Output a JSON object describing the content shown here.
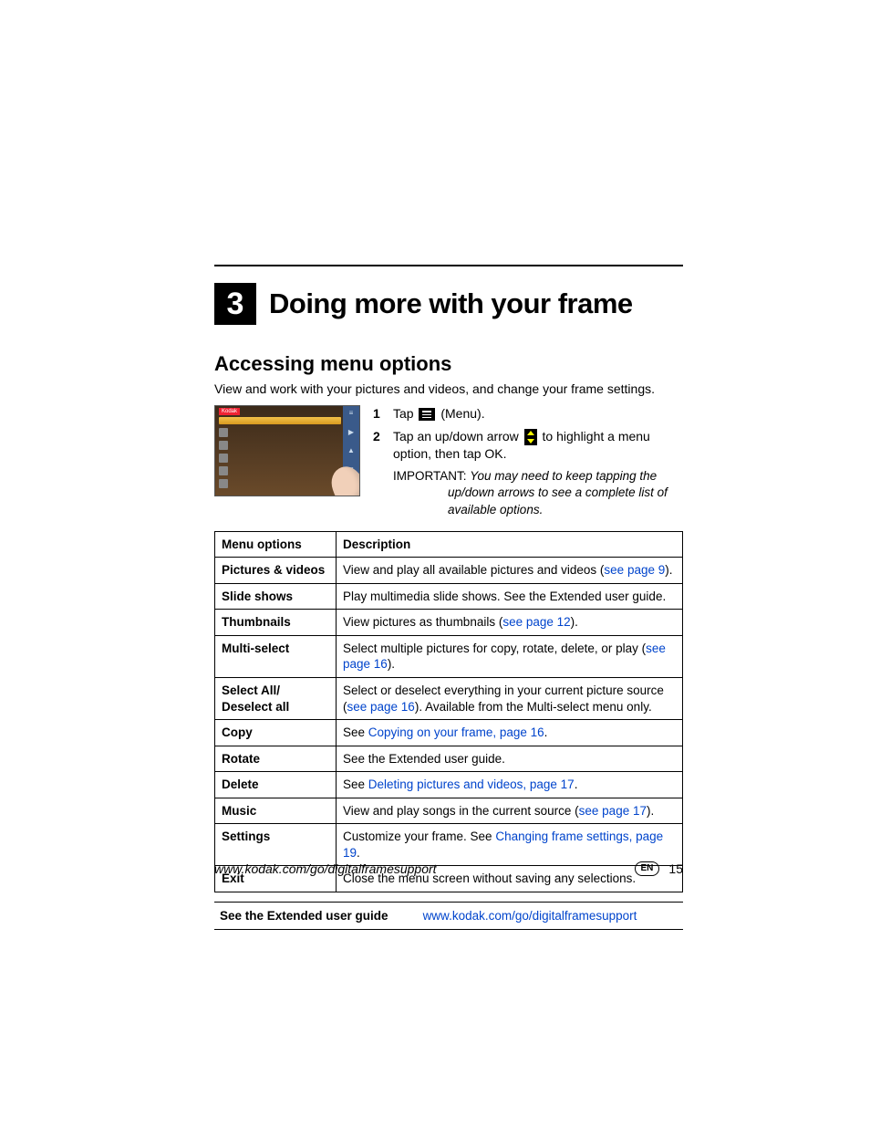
{
  "chapter": {
    "number": "3",
    "title": "Doing more with your frame"
  },
  "section": {
    "title": "Accessing menu options"
  },
  "intro": "View and work with your pictures and videos, and change your frame settings.",
  "steps": {
    "s1": {
      "num": "1",
      "pre": "Tap ",
      "post": " (Menu)."
    },
    "s2": {
      "num": "2",
      "pre": "Tap an up/down arrow ",
      "post": " to highlight a menu option, then tap OK."
    }
  },
  "important": {
    "label": "IMPORTANT: ",
    "text": "You may need to keep tapping the up/down arrows to see a complete list of available options."
  },
  "table": {
    "h1": "Menu options",
    "h2": "Description",
    "rows": [
      {
        "menu": "Pictures & videos",
        "desc_pre": "View and play all available pictures and videos (",
        "link": "see page 9",
        "desc_post": ")."
      },
      {
        "menu": "Slide shows",
        "desc_pre": "Play multimedia slide shows. See the Extended user guide.",
        "link": "",
        "desc_post": ""
      },
      {
        "menu": "Thumbnails",
        "desc_pre": "View pictures as thumbnails (",
        "link": "see page 12",
        "desc_post": ")."
      },
      {
        "menu": "Multi-select",
        "desc_pre": "Select multiple pictures for copy, rotate, delete, or play (",
        "link": "see page 16",
        "desc_post": ")."
      },
      {
        "menu": "Select All/ Deselect all",
        "desc_pre": "Select or deselect everything in your current picture source (",
        "link": "see page 16",
        "desc_post": "). Available from the Multi-select menu only."
      },
      {
        "menu": "Copy",
        "desc_pre": "See ",
        "link": "Copying on your frame, page 16",
        "desc_post": "."
      },
      {
        "menu": "Rotate",
        "desc_pre": "See the Extended user guide.",
        "link": "",
        "desc_post": ""
      },
      {
        "menu": "Delete",
        "desc_pre": "See ",
        "link": "Deleting pictures and videos, page 17",
        "desc_post": "."
      },
      {
        "menu": "Music",
        "desc_pre": "View and play songs in the current source (",
        "link": "see page 17",
        "desc_post": ")."
      },
      {
        "menu": "Settings",
        "desc_pre": "Customize your frame. See ",
        "link": "Changing frame settings, page 19",
        "desc_post": "."
      },
      {
        "menu": "Exit",
        "desc_pre": "Close the menu screen without saving any selections.",
        "link": "",
        "desc_post": ""
      }
    ]
  },
  "ext_guide": {
    "label": "See the Extended user guide",
    "url": "www.kodak.com/go/digitalframesupport"
  },
  "footer": {
    "url": "www.kodak.com/go/digitalframesupport",
    "lang": "EN",
    "page": "15"
  }
}
